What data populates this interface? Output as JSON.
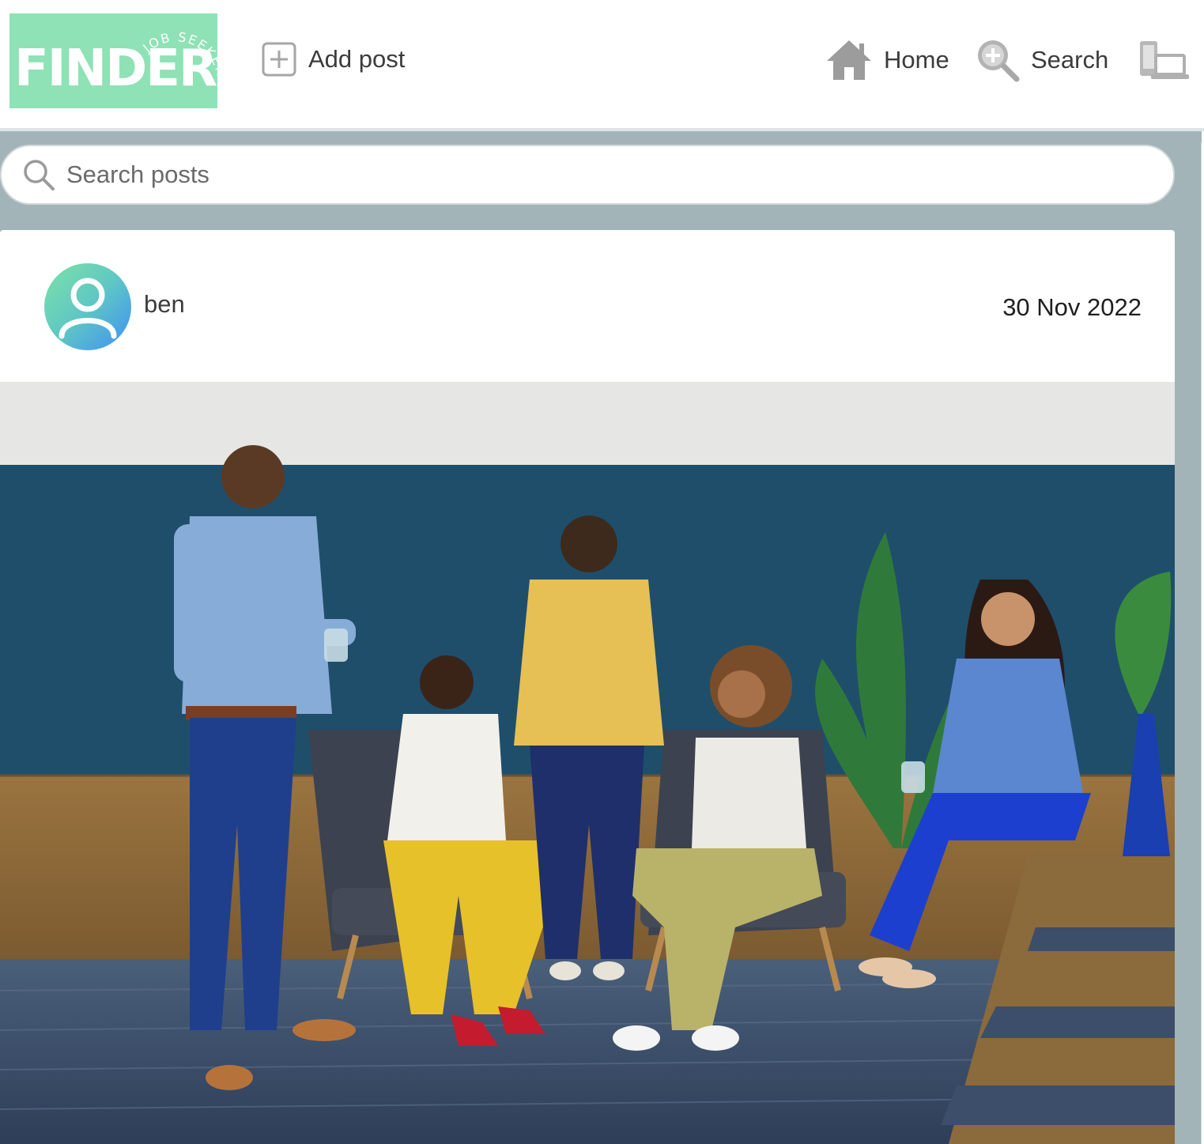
{
  "navbar": {
    "logo": {
      "main_text": "FINDER",
      "sub_text": "JOB SEEKERS",
      "color": "#8ee2b5"
    },
    "add_post_label": "Add post",
    "home_label": "Home",
    "search_label": "Search",
    "icons": {
      "add_post": "add-square-icon",
      "home": "home-icon",
      "search": "search-plus-icon",
      "logout": "devices-icon"
    }
  },
  "search": {
    "placeholder": "Search posts",
    "value": ""
  },
  "post": {
    "author": "ben",
    "date": "30 Nov 2022",
    "avatar_icon": "user-icon",
    "image_subject": "photo of five coworkers chatting in an office lounge"
  },
  "colors": {
    "accent": "#8ee2b5",
    "page_background": "#a2b4b8",
    "wall_blue": "#1f4e6b"
  }
}
